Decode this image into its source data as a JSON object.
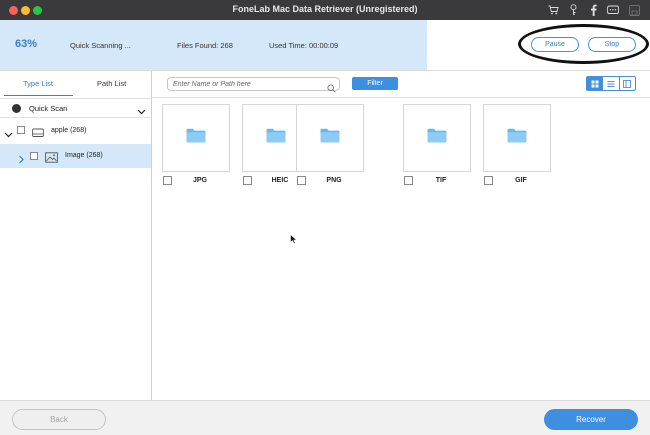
{
  "window": {
    "title": "FoneLab Mac Data Retriever (Unregistered)",
    "toolbar_icons": [
      "cart-icon",
      "key-icon",
      "facebook-icon",
      "chat-icon",
      "save-icon"
    ]
  },
  "scan": {
    "percent_label": "63%",
    "progress_fraction": 0.63,
    "status": "Quick Scanning ...",
    "files_found": "Files Found: 268",
    "used_time": "Used Time: 00:00:09",
    "pause_label": "Pause",
    "stop_label": "Stop"
  },
  "sidebar": {
    "tabs": [
      {
        "label": "Type List",
        "active": true
      },
      {
        "label": "Path List",
        "active": false
      }
    ],
    "scan_mode": "Quick Scan",
    "tree": [
      {
        "label": "apple (268)",
        "icon": "drive-icon",
        "expanded": true
      },
      {
        "label": "Image (268)",
        "icon": "image-icon",
        "selected": true
      }
    ]
  },
  "main": {
    "search_placeholder": "Enter Name or Path here",
    "filter_label": "Filter",
    "view_modes": [
      "grid-view-icon",
      "list-view-icon",
      "detail-view-icon"
    ],
    "active_view": "grid-view-icon",
    "folders": [
      {
        "label": "JPG"
      },
      {
        "label": "HEIC"
      },
      {
        "label": "PNG"
      },
      {
        "label": "TIF"
      },
      {
        "label": "GIF"
      }
    ]
  },
  "footer": {
    "back_label": "Back",
    "recover_label": "Recover"
  },
  "colors": {
    "accent": "#3f8fe0",
    "progress_fill": "#d4e8fa",
    "titlebar": "#3a3a3c"
  }
}
